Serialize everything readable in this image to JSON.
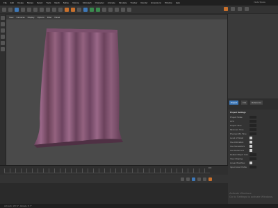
{
  "menubar": {
    "items": [
      "File",
      "Edit",
      "Create",
      "Modes",
      "Select",
      "Tools",
      "Mesh",
      "Spline",
      "Volume",
      "MoGraph",
      "Character",
      "Animate",
      "Simulate",
      "Tracker",
      "Render",
      "Extensions",
      "Window",
      "Help"
    ],
    "right": "Node Space"
  },
  "viewport_menu": [
    "View",
    "Cameras",
    "Display",
    "Options",
    "Filter",
    "Panel"
  ],
  "attributes": {
    "tabs": [
      "Project",
      "Info",
      "Reference"
    ],
    "title": "Project Settings",
    "rows": [
      {
        "label": "Project Scale",
        "has_checkbox": false
      },
      {
        "label": "FPS",
        "has_checkbox": false
      },
      {
        "label": "Project Time",
        "has_checkbox": false
      },
      {
        "label": "Minimum Time",
        "has_checkbox": false
      },
      {
        "label": "Preview Min Time",
        "has_checkbox": false
      },
      {
        "label": "Level of Detail",
        "has_checkbox": true
      },
      {
        "label": "Use Animation",
        "has_checkbox": true
      },
      {
        "label": "Use Generators",
        "has_checkbox": true
      },
      {
        "label": "Use Deformers",
        "has_checkbox": true
      },
      {
        "label": "Default Object Color",
        "has_checkbox": false
      },
      {
        "label": "View Clipping",
        "has_checkbox": false
      },
      {
        "label": "Linear Workflow",
        "has_checkbox": true
      },
      {
        "label": "Input Color Profile",
        "has_checkbox": false
      }
    ]
  },
  "timeline": {
    "frame_readout": "0 F"
  },
  "status": "Azimuth: 157.4°, Altitude: 8.7°",
  "watermark": {
    "line1": "Activate Windows",
    "line2": "Go to Settings to activate Windows."
  },
  "colors": {
    "curtain": "#8a5a78",
    "viewport_bg": "#4a4a4a",
    "accent": "#3e78b8"
  }
}
